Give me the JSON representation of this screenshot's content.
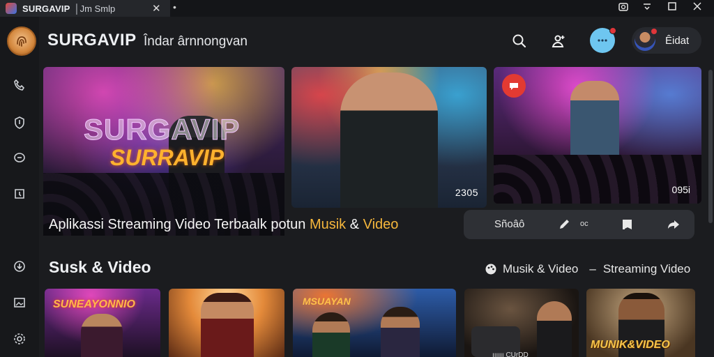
{
  "window": {
    "tab_title": "SURGAVIP",
    "tab_subtitle": "│Jm Smlp",
    "tab_close": "✕",
    "new_tab": "•"
  },
  "header": {
    "brand": "SURGAVIP",
    "subtitle": "Îndar ârnnongvan",
    "profile_name": "Êidat"
  },
  "hero": {
    "banner_text_1": "SURGAVIP",
    "banner_text_2": "SURRAVIP",
    "card2_duration": "2305",
    "card3_duration": "095i",
    "caption_pre": "Aplikassi Streaming Video Terbaalk potun ",
    "caption_hl1": "Musik",
    "caption_mid": " & ",
    "caption_hl2": "Video"
  },
  "actions": {
    "label": "Sñoâô",
    "small": "oc"
  },
  "section": {
    "title": "Susk & Video",
    "filter_1": "Musik & Video",
    "separator": "–",
    "filter_2": "Streaming Video"
  },
  "thumbnails": {
    "thumb1_text": "SUNEAYONNIO",
    "thumb3_text": "MSUAYAN",
    "thumb4_text": "ıııııı CUrDD",
    "thumb5_text": "MUNIK&VIDEO"
  },
  "colors": {
    "background": "#1b1c1f",
    "accent": "#f6b73c",
    "record": "#e23a32",
    "chat": "#6ec6f0"
  }
}
